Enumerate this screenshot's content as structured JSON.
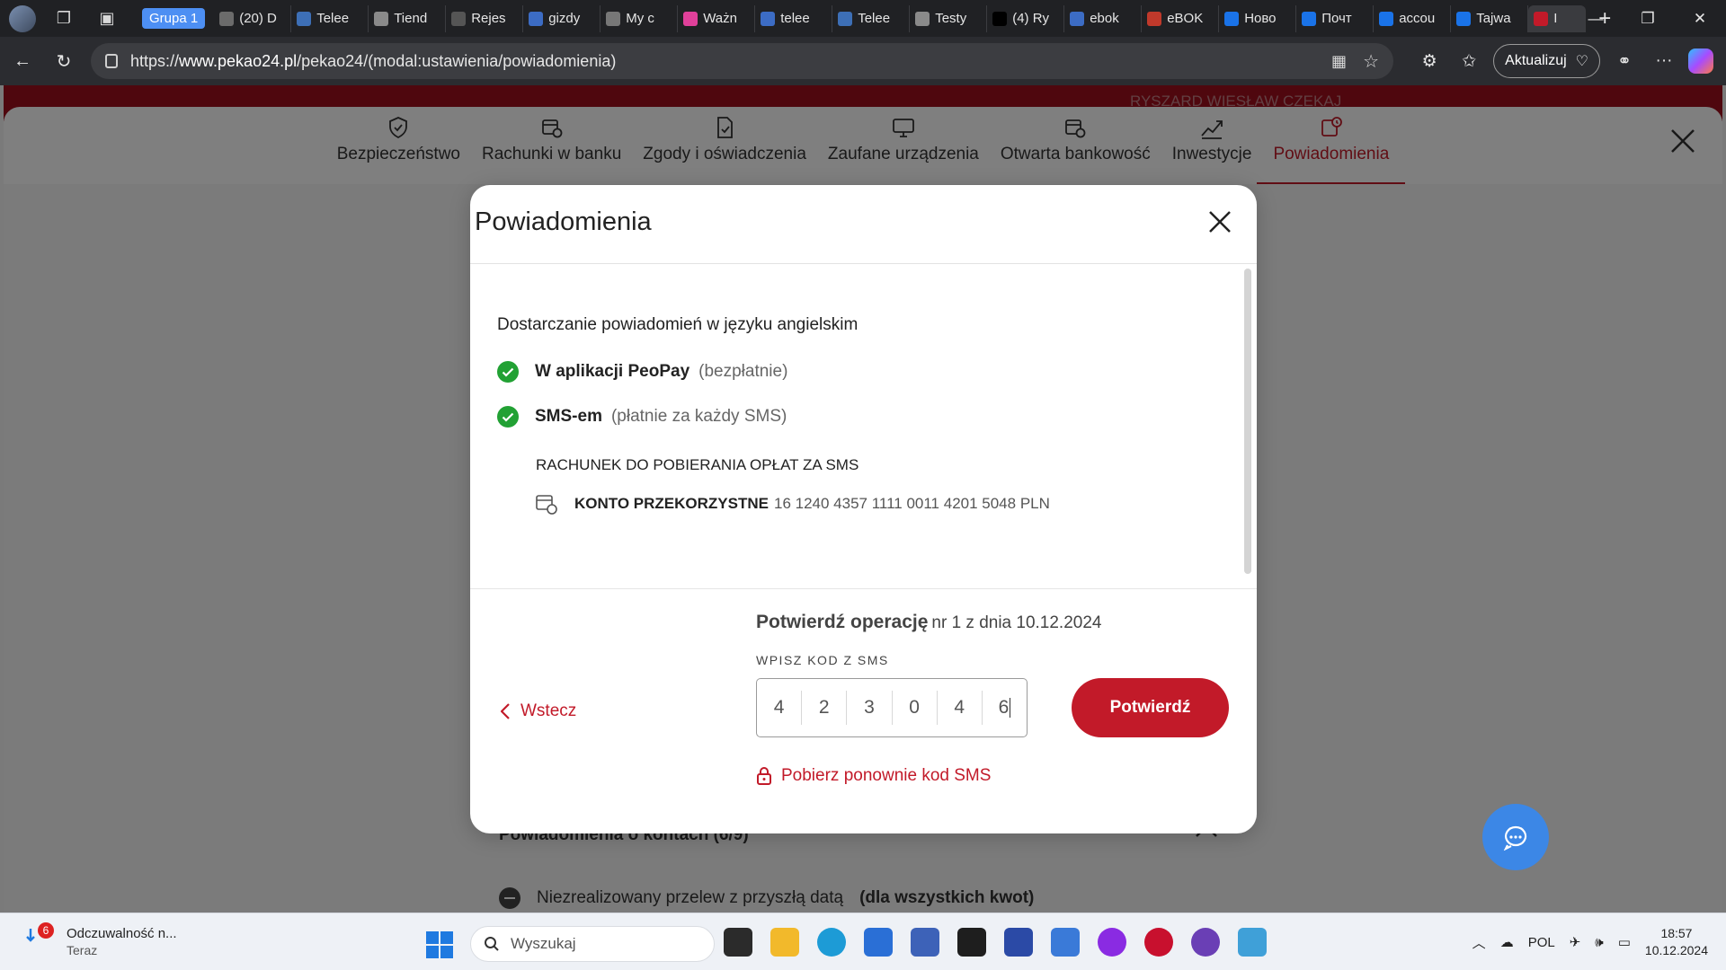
{
  "browser": {
    "tab_group": "Grupa 1",
    "tabs": [
      {
        "label": "(20) D",
        "color": "#6b6b6b"
      },
      {
        "label": "Telee",
        "color": "#3d6fb6"
      },
      {
        "label": "Tiend",
        "color": "#8a8a8a"
      },
      {
        "label": "Rejes",
        "color": "#555555"
      },
      {
        "label": "gizdy",
        "color": "#3c6cc4"
      },
      {
        "label": "My c",
        "color": "#777777"
      },
      {
        "label": "Ważn",
        "color": "#e0409a"
      },
      {
        "label": "telee",
        "color": "#3c6cc4"
      },
      {
        "label": "Telee",
        "color": "#3d6fb6"
      },
      {
        "label": "Testy",
        "color": "#8a8a8a"
      },
      {
        "label": "(4) Ry",
        "color": "#000000"
      },
      {
        "label": "ebok",
        "color": "#3c6cc4"
      },
      {
        "label": "eBOK",
        "color": "#c0392b"
      },
      {
        "label": "Ново",
        "color": "#1a73e8"
      },
      {
        "label": "Почт",
        "color": "#1a73e8"
      },
      {
        "label": "accou",
        "color": "#1a73e8"
      },
      {
        "label": "Tajwa",
        "color": "#1a73e8"
      },
      {
        "label": "I",
        "color": "#c21a29"
      }
    ],
    "url_prefix": "https://",
    "url_host": "www.pekao24.pl",
    "url_path": "/pekao24/(modal:ustawienia/powiadomienia)",
    "update_label": "Aktualizuj"
  },
  "page": {
    "header_user": "RYSZARD WIESŁAW CZEKAJ",
    "nav": [
      {
        "label": "Bezpieczeństwo",
        "icon": "shield-icon",
        "active": false
      },
      {
        "label": "Rachunki w banku",
        "icon": "accounts-icon",
        "active": false
      },
      {
        "label": "Zgody i oświadczenia",
        "icon": "document-check-icon",
        "active": false
      },
      {
        "label": "Zaufane urządzenia",
        "icon": "monitor-icon",
        "active": false
      },
      {
        "label": "Otwarta bankowość",
        "icon": "open-banking-icon",
        "active": false
      },
      {
        "label": "Inwestycje",
        "icon": "chart-line-icon",
        "active": false
      },
      {
        "label": "Powiadomienia",
        "icon": "bell-calendar-icon",
        "active": true
      }
    ],
    "background_section": "Powiadomienia o kontach (6/9)",
    "background_item": "Niezrealizowany przelew z przyszłą datą",
    "background_item_bold": "(dla wszystkich kwot)"
  },
  "modal": {
    "title": "Powiadomienia",
    "body_title": "Dostarczanie powiadomień w języku angielskim",
    "options": [
      {
        "label": "W aplikacji PeoPay",
        "note": "(bezpłatnie)"
      },
      {
        "label": "SMS-em",
        "note": "(płatnie za każdy SMS)"
      }
    ],
    "account_label": "RACHUNEK DO POBIERANIA OPŁAT ZA SMS",
    "account_name": "KONTO PRZEKORZYSTNE",
    "account_number": "16 1240 4357 1111 0011 4201 5048 PLN",
    "back_label": "Wstecz",
    "confirm_title": "Potwierdź operację",
    "confirm_subtitle": "nr 1 z dnia 10.12.2024",
    "sms_label": "WPISZ KOD Z SMS",
    "code_digits": [
      "4",
      "2",
      "3",
      "0",
      "4",
      "6"
    ],
    "confirm_button": "Potwierdź",
    "resend_label": "Pobierz ponownie kod SMS"
  },
  "colors": {
    "brand_red": "#c21a29",
    "check_green": "#22a134",
    "chat_blue": "#3c87e6"
  },
  "taskbar": {
    "notification_count": "6",
    "notification_title": "Odczuwalność n...",
    "notification_time": "Teraz",
    "search_placeholder": "Wyszukaj",
    "language": "POL",
    "time": "18:57",
    "date": "10.12.2024"
  }
}
